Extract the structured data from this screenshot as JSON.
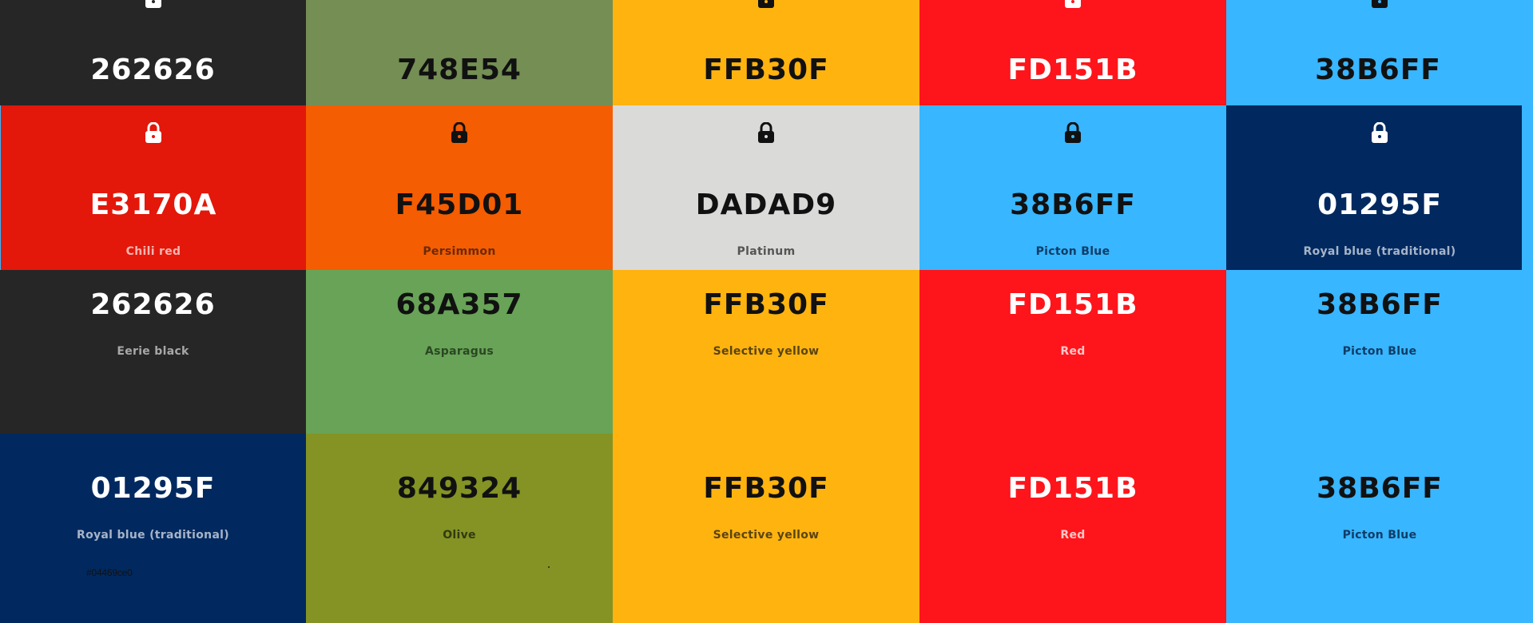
{
  "palette": {
    "row1": [
      {
        "hex": "262626",
        "bg": "#262626",
        "fg": "dark",
        "name_color": "#b9b9b9",
        "lock_color": "#ffffff"
      },
      {
        "hex": "748E54",
        "bg": "#748E54",
        "fg": "light",
        "name_color": "#2a3320",
        "lock_color": "#111111"
      },
      {
        "hex": "FFB30F",
        "bg": "#FFB30F",
        "fg": "light",
        "name_color": "#5a4410",
        "lock_color": "#111111"
      },
      {
        "hex": "FD151B",
        "bg": "#FD151B",
        "fg": "dark",
        "name_color": "#ffc7c8",
        "lock_color": "#ffffff"
      },
      {
        "hex": "38B6FF",
        "bg": "#38B6FF",
        "fg": "light",
        "name_color": "#0f3c66",
        "lock_color": "#111111"
      }
    ],
    "row2": [
      {
        "hex": "E3170A",
        "name": "Chili red",
        "bg": "#E3170A",
        "fg": "dark",
        "name_color": "#f6b6b0",
        "lock_color": "#ffffff"
      },
      {
        "hex": "F45D01",
        "name": "Persimmon",
        "bg": "#F45D01",
        "fg": "light",
        "name_color": "#6b2a06",
        "lock_color": "#111111"
      },
      {
        "hex": "DADAD9",
        "name": "Platinum",
        "bg": "#DADAD9",
        "fg": "light",
        "name_color": "#555555",
        "lock_color": "#111111"
      },
      {
        "hex": "38B6FF",
        "name": "Picton Blue",
        "bg": "#38B6FF",
        "fg": "light",
        "name_color": "#0f3c66",
        "lock_color": "#111111"
      },
      {
        "hex": "01295F",
        "name": "Royal blue (traditional)",
        "bg": "#01295F",
        "fg": "dark",
        "name_color": "#a7b4c8",
        "lock_color": "#ffffff"
      }
    ],
    "row3": [
      {
        "hex": "262626",
        "name": "Eerie black",
        "bg": "#262626",
        "fg": "dark",
        "name_color": "#a8a8a8"
      },
      {
        "hex": "68A357",
        "name": "Asparagus",
        "bg": "#68A357",
        "fg": "light",
        "name_color": "#2a4722"
      },
      {
        "hex": "FFB30F",
        "name": "Selective yellow",
        "bg": "#FFB30F",
        "fg": "light",
        "name_color": "#5a4410"
      },
      {
        "hex": "FD151B",
        "name": "Red",
        "bg": "#FD151B",
        "fg": "dark",
        "name_color": "#ffc7c8"
      },
      {
        "hex": "38B6FF",
        "name": "Picton Blue",
        "bg": "#38B6FF",
        "fg": "light",
        "name_color": "#0f3c66"
      }
    ],
    "row4": [
      {
        "hex": "01295F",
        "name": "Royal blue (traditional)",
        "bg": "#01295F",
        "fg": "dark",
        "name_color": "#a7b4c8"
      },
      {
        "hex": "849324",
        "name": "Olive",
        "bg": "#849324",
        "fg": "light",
        "name_color": "#333a10"
      },
      {
        "hex": "FFB30F",
        "name": "Selective yellow",
        "bg": "#FFB30F",
        "fg": "light",
        "name_color": "#5a4410"
      },
      {
        "hex": "FD151B",
        "name": "Red",
        "bg": "#FD151B",
        "fg": "dark",
        "name_color": "#ffc7c8"
      },
      {
        "hex": "38B6FF",
        "name": "Picton Blue",
        "bg": "#38B6FF",
        "fg": "light",
        "name_color": "#0f3c66"
      }
    ]
  },
  "note_text": "#04469ce0"
}
